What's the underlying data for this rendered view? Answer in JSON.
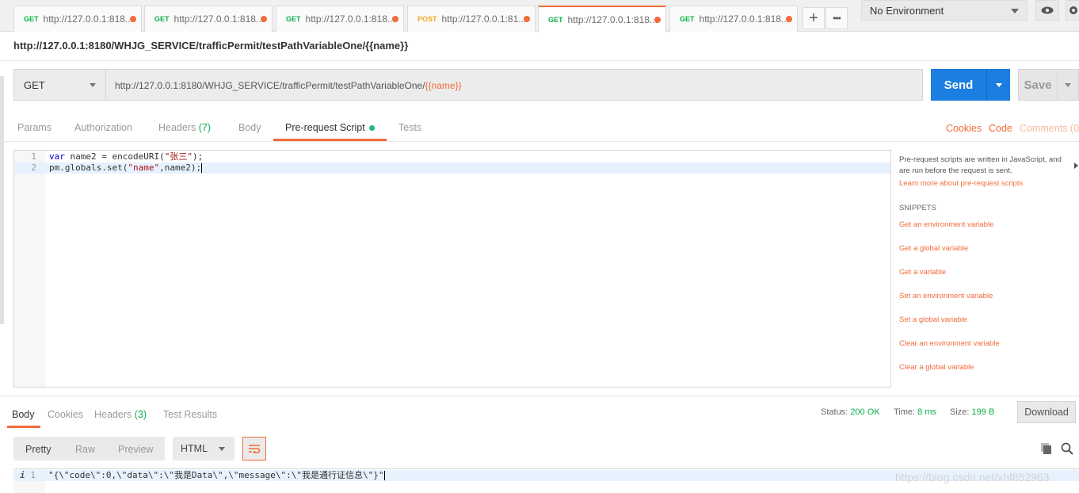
{
  "tabs": [
    {
      "method": "GET",
      "url": "http://127.0.0.1:818..."
    },
    {
      "method": "GET",
      "url": "http://127.0.0.1:818..."
    },
    {
      "method": "GET",
      "url": "http://127.0.0.1:818..."
    },
    {
      "method": "POST",
      "url": "http://127.0.0.1:81..."
    },
    {
      "method": "GET",
      "url": "http://127.0.0.1:818..."
    },
    {
      "method": "GET",
      "url": "http://127.0.0.1:818..."
    }
  ],
  "tab_actions": {
    "add": "+",
    "more": "•••"
  },
  "environment": {
    "selected": "No Environment"
  },
  "request": {
    "title": "http://127.0.0.1:8180/WHJG_SERVICE/trafficPermit/testPathVariableOne/{{name}}",
    "method": "GET",
    "url_base": "http://127.0.0.1:8180/WHJG_SERVICE/trafficPermit/testPathVariableOne/",
    "url_var": "{{name}}",
    "send_label": "Send",
    "save_label": "Save"
  },
  "request_tabs": {
    "params": "Params",
    "authorization": "Authorization",
    "headers": "Headers",
    "headers_count": "(7)",
    "body": "Body",
    "prerequest": "Pre-request Script",
    "tests": "Tests",
    "cookies": "Cookies",
    "code": "Code",
    "comments": "Comments (0"
  },
  "editor": {
    "lines": [
      {
        "num": "1",
        "kw": "var",
        "rest": " name2 = encodeURI(",
        "str": "\"张三\"",
        "tail": ");"
      },
      {
        "num": "2",
        "pre": "pm.globals.set(",
        "str": "\"name\"",
        "tail": ",name2);"
      }
    ]
  },
  "snippets": {
    "description": "Pre-request scripts are written in JavaScript, and are run before the request is sent.",
    "learn_more": "Learn more about pre-request scripts",
    "heading": "SNIPPETS",
    "items": [
      "Get an environment variable",
      "Get a global variable",
      "Get a variable",
      "Set an environment variable",
      "Set a global variable",
      "Clear an environment variable",
      "Clear a global variable"
    ]
  },
  "response": {
    "tabs": {
      "body": "Body",
      "cookies": "Cookies",
      "headers": "Headers",
      "headers_count": "(3)",
      "test_results": "Test Results"
    },
    "status_label": "Status:",
    "status_value": "200 OK",
    "time_label": "Time:",
    "time_value": "8 ms",
    "size_label": "Size:",
    "size_value": "199 B",
    "download_label": "Download",
    "formats": {
      "pretty": "Pretty",
      "raw": "Raw",
      "preview": "Preview"
    },
    "language": "HTML",
    "line_num": "1",
    "info_marker": "i",
    "body_text": "\"{\\\"code\\\":0,\\\"data\\\":\\\"我是Data\\\",\\\"message\\\":\\\"我是通行证信息\\\"}\""
  },
  "watermark": "https://blog.csdn.net/xhf852963",
  "colors": {
    "accent": "#f26b3a",
    "send": "#1b7ee0",
    "get": "#0cb14b",
    "post": "#f5a623",
    "status_ok": "#0cb14b"
  }
}
